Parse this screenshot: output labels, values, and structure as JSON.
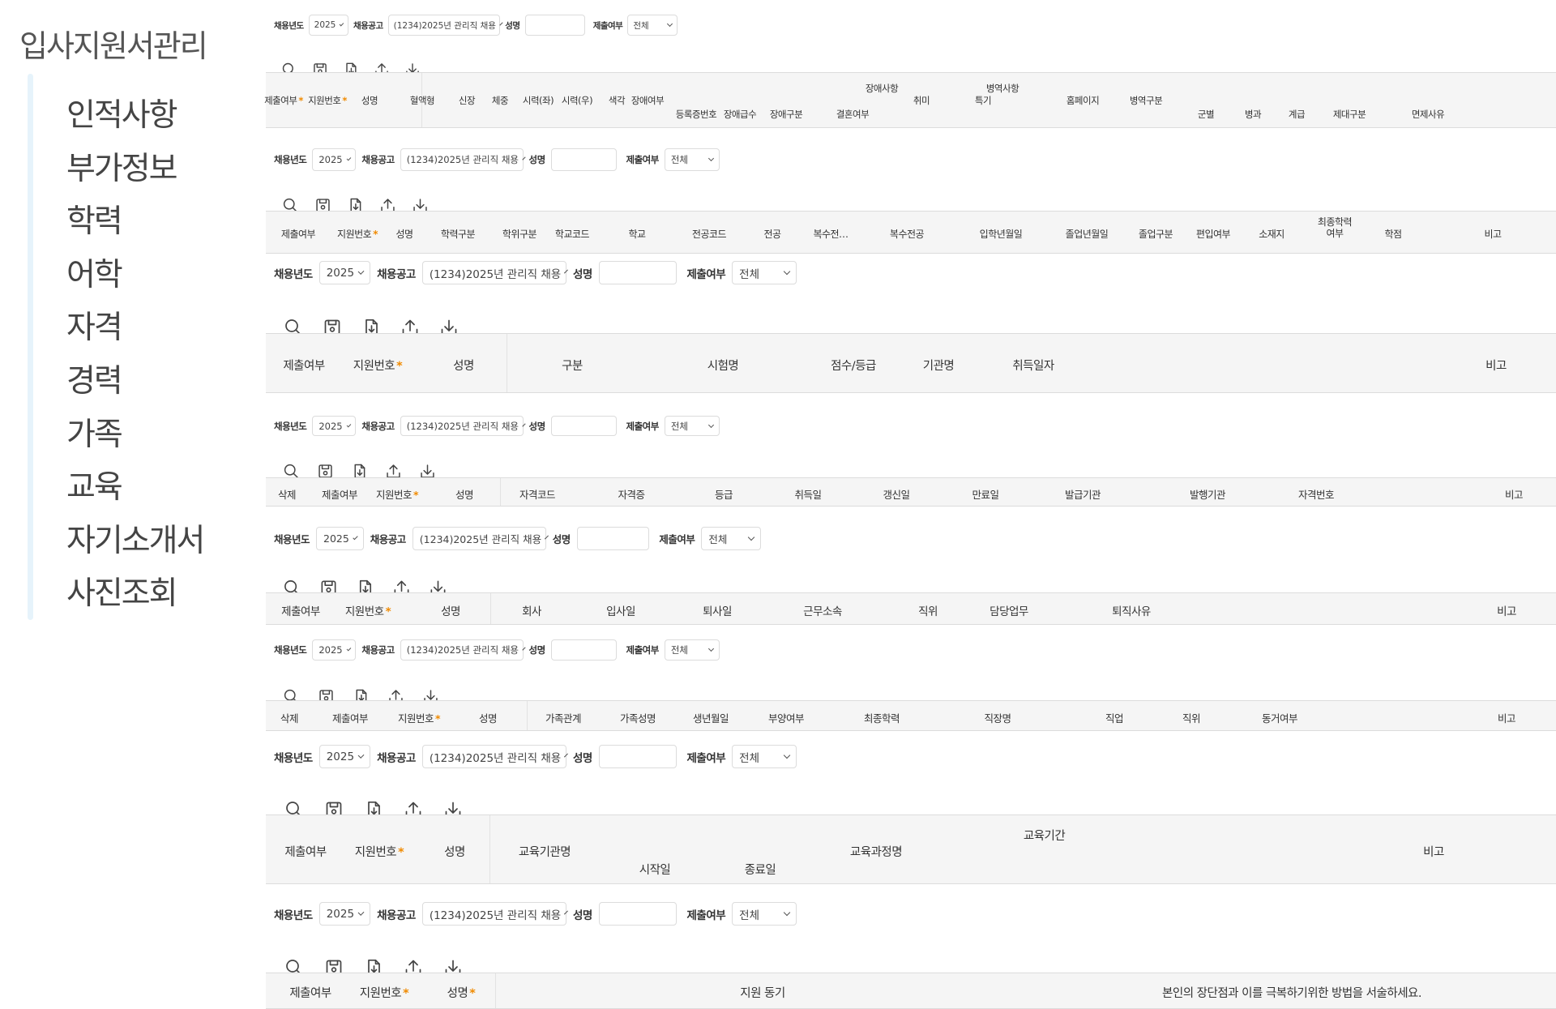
{
  "app_title": "입사지원서관리",
  "nav_items": [
    "인적사항",
    "부가정보",
    "학력",
    "어학",
    "자격",
    "경력",
    "가족",
    "교육",
    "자기소개서",
    "사진조회"
  ],
  "search": {
    "year_label": "채용년도",
    "year_value": "2025",
    "notice_label": "채용공고",
    "notice_value": "(1234)2025년 관리직 채용",
    "name_label": "성명",
    "name_value": "",
    "submit_label": "제출여부",
    "submit_value": "전체"
  },
  "toolbar_icons": [
    "search-icon",
    "save-icon",
    "download-file-icon",
    "upload-icon",
    "download-icon"
  ],
  "colors": {
    "required_star": "#f08a00",
    "nav_rail": "#e6f3fb",
    "header_bg": "#f5f5f5"
  },
  "sections": [
    {
      "id": "personal",
      "groups": [
        {
          "label": "장애사항"
        },
        {
          "label": "병역사항"
        }
      ],
      "headers": [
        {
          "label": "제출여부",
          "required": true
        },
        {
          "label": "지원번호",
          "required": true
        },
        {
          "label": "성명"
        },
        {
          "label": "혈액형"
        },
        {
          "label": "신장"
        },
        {
          "label": "체중"
        },
        {
          "label": "시력(좌)"
        },
        {
          "label": "시력(우)"
        },
        {
          "label": "색각"
        },
        {
          "label": "장애여부"
        },
        {
          "label": "등록증번호"
        },
        {
          "label": "장애급수"
        },
        {
          "label": "장애구분"
        },
        {
          "label": "결혼여부"
        },
        {
          "label": "취미"
        },
        {
          "label": "특기"
        },
        {
          "label": "홈페이지"
        },
        {
          "label": "병역구분"
        },
        {
          "label": "군별"
        },
        {
          "label": "병과"
        },
        {
          "label": "계급"
        },
        {
          "label": "제대구분"
        },
        {
          "label": "면제사유"
        }
      ]
    },
    {
      "id": "education",
      "headers": [
        {
          "label": "제출여부"
        },
        {
          "label": "지원번호",
          "required": true
        },
        {
          "label": "성명"
        },
        {
          "label": "학력구분"
        },
        {
          "label": "학위구분"
        },
        {
          "label": "학교코드"
        },
        {
          "label": "학교"
        },
        {
          "label": "전공코드"
        },
        {
          "label": "전공"
        },
        {
          "label": "복수전…"
        },
        {
          "label": "복수전공"
        },
        {
          "label": "입학년월일"
        },
        {
          "label": "졸업년월일"
        },
        {
          "label": "졸업구분"
        },
        {
          "label": "편입여부"
        },
        {
          "label": "소재지"
        },
        {
          "label": "최종학력 여부"
        },
        {
          "label": "학점"
        },
        {
          "label": "비고"
        }
      ]
    },
    {
      "id": "language",
      "headers": [
        {
          "label": "제출여부"
        },
        {
          "label": "지원번호",
          "required": true
        },
        {
          "label": "성명"
        },
        {
          "label": "구분"
        },
        {
          "label": "시험명"
        },
        {
          "label": "점수/등급"
        },
        {
          "label": "기관명"
        },
        {
          "label": "취득일자"
        },
        {
          "label": "비고"
        }
      ]
    },
    {
      "id": "license",
      "headers": [
        {
          "label": "삭제"
        },
        {
          "label": "제출여부"
        },
        {
          "label": "지원번호",
          "required": true
        },
        {
          "label": "성명"
        },
        {
          "label": "자격코드"
        },
        {
          "label": "자격증"
        },
        {
          "label": "등급"
        },
        {
          "label": "취득일"
        },
        {
          "label": "갱신일"
        },
        {
          "label": "만료일"
        },
        {
          "label": "발급기관"
        },
        {
          "label": "발행기관"
        },
        {
          "label": "자격번호"
        },
        {
          "label": "비고"
        }
      ]
    },
    {
      "id": "career",
      "headers": [
        {
          "label": "제출여부"
        },
        {
          "label": "지원번호",
          "required": true
        },
        {
          "label": "성명"
        },
        {
          "label": "회사"
        },
        {
          "label": "입사일"
        },
        {
          "label": "퇴사일"
        },
        {
          "label": "근무소속"
        },
        {
          "label": "직위"
        },
        {
          "label": "담당업무"
        },
        {
          "label": "퇴직사유"
        },
        {
          "label": "비고"
        }
      ]
    },
    {
      "id": "family",
      "headers": [
        {
          "label": "삭제"
        },
        {
          "label": "제출여부"
        },
        {
          "label": "지원번호",
          "required": true
        },
        {
          "label": "성명"
        },
        {
          "label": "가족관계"
        },
        {
          "label": "가족성명"
        },
        {
          "label": "생년월일"
        },
        {
          "label": "부양여부"
        },
        {
          "label": "최종학력"
        },
        {
          "label": "직장명"
        },
        {
          "label": "직업"
        },
        {
          "label": "직위"
        },
        {
          "label": "동거여부"
        },
        {
          "label": "비고"
        }
      ]
    },
    {
      "id": "training",
      "groups": [
        {
          "label": "교육기간"
        }
      ],
      "headers": [
        {
          "label": "제출여부"
        },
        {
          "label": "지원번호",
          "required": true
        },
        {
          "label": "성명"
        },
        {
          "label": "교육기관명"
        },
        {
          "label": "시작일"
        },
        {
          "label": "종료일"
        },
        {
          "label": "교육과정명"
        },
        {
          "label": "비고"
        }
      ]
    },
    {
      "id": "intro",
      "headers": [
        {
          "label": "제출여부"
        },
        {
          "label": "지원번호",
          "required": true
        },
        {
          "label": "성명",
          "required": true
        },
        {
          "label": "지원 동기"
        },
        {
          "label": "본인의 장단점과 이를 극복하기위한 방법을 서술하세요."
        }
      ]
    }
  ]
}
